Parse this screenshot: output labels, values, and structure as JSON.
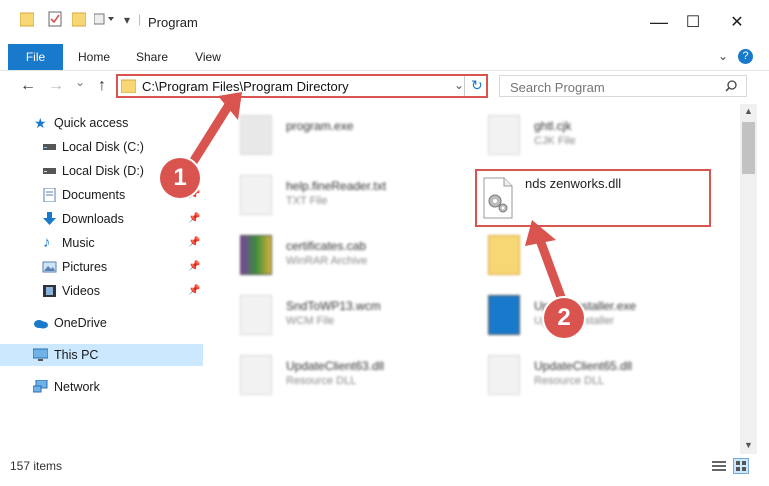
{
  "window": {
    "title": "Program",
    "minimize": "—",
    "maximize": "☐",
    "close": "✕"
  },
  "ribbon": {
    "tabs": [
      {
        "label": "File"
      },
      {
        "label": "Home"
      },
      {
        "label": "Share"
      },
      {
        "label": "View"
      }
    ],
    "help": "?"
  },
  "nav": {
    "back": "←",
    "forward": "→",
    "recent": "⌄",
    "up": "↑",
    "address": "C:\\Program Files\\Program Directory",
    "search_placeholder": "Search Program"
  },
  "sidebar": {
    "items": [
      {
        "label": "Quick access",
        "icon": "star-icon"
      },
      {
        "label": "Local Disk (C:)",
        "icon": "drive-icon"
      },
      {
        "label": "Local Disk (D:)",
        "icon": "drive-icon"
      },
      {
        "label": "Documents",
        "icon": "documents-icon"
      },
      {
        "label": "Downloads",
        "icon": "download-icon"
      },
      {
        "label": "Music",
        "icon": "music-icon"
      },
      {
        "label": "Pictures",
        "icon": "pictures-icon"
      },
      {
        "label": "Videos",
        "icon": "videos-icon"
      },
      {
        "label": "OneDrive",
        "icon": "cloud-icon"
      },
      {
        "label": "This PC",
        "icon": "computer-icon"
      },
      {
        "label": "Network",
        "icon": "network-icon"
      }
    ]
  },
  "files": {
    "left": [
      {
        "name": "program.exe",
        "type": ""
      },
      {
        "name": "help.fineReader.txt",
        "type": "TXT File"
      },
      {
        "name": "certificates.cab",
        "type": "WinRAR Archive"
      },
      {
        "name": "SndToWP13.wcm",
        "type": "WCM File"
      },
      {
        "name": "UpdateClient63.dll",
        "type": "Resource DLL"
      }
    ],
    "right": [
      {
        "name": "ghtl.cjk",
        "type": "CJK File"
      },
      {
        "name": "",
        "type": ""
      },
      {
        "name": "Updateinstaller.exe",
        "type": "Updater installer"
      },
      {
        "name": "UpdateClient65.dll",
        "type": "Resource DLL"
      }
    ],
    "highlighted": {
      "name": "nds zenworks.dll"
    }
  },
  "callouts": {
    "one": "1",
    "two": "2"
  },
  "status": {
    "count": "157 items"
  },
  "colors": {
    "accent": "#1979ca",
    "callout": "#d9534f",
    "selected": "#cce8ff"
  }
}
